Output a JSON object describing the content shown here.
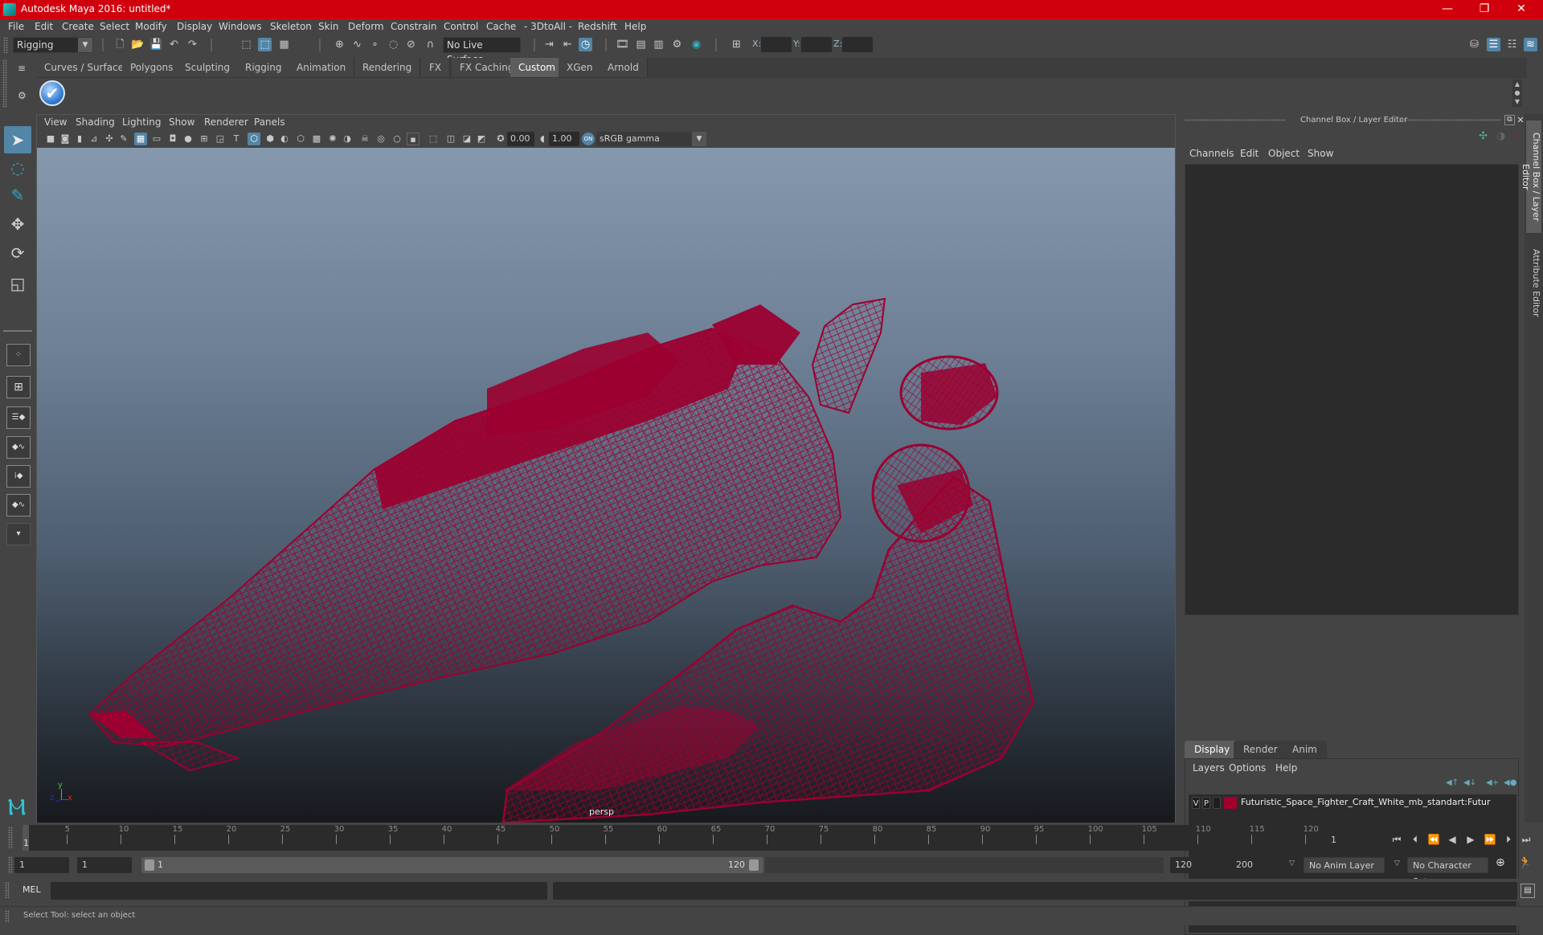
{
  "window": {
    "title": "Autodesk Maya 2016: untitled*",
    "controls": {
      "minimize": "—",
      "restore": "❐",
      "close": "✕"
    }
  },
  "menubar": [
    "File",
    "Edit",
    "Create",
    "Select",
    "Modify",
    "Display",
    "Windows",
    "Skeleton",
    "Skin",
    "Deform",
    "Constrain",
    "Control",
    "Cache",
    "- 3DtoAll -",
    "Redshift",
    "Help"
  ],
  "statusline": {
    "menuset": "Rigging",
    "live_surface": "No Live Surface",
    "x_label": "X:",
    "y_label": "Y:",
    "z_label": "Z:",
    "x_value": "",
    "y_value": "",
    "z_value": ""
  },
  "shelf": {
    "tabs": [
      "Curves / Surfaces",
      "Polygons",
      "Sculpting",
      "Rigging",
      "Animation",
      "Rendering",
      "FX",
      "FX Caching",
      "Custom",
      "XGen",
      "Arnold"
    ],
    "active_tab": "Custom",
    "items": [
      {
        "icon": "checkmark-icon",
        "glyph": "✔"
      }
    ]
  },
  "viewport": {
    "menu": [
      "View",
      "Shading",
      "Lighting",
      "Show",
      "Renderer",
      "Panels"
    ],
    "exposure": "0.00",
    "gamma": "1.00",
    "color_space": "sRGB gamma",
    "camera_label": "persp",
    "axis": {
      "x": "x",
      "y": "y",
      "z": "z"
    },
    "wireframe_color": "#9b0030"
  },
  "channel_box": {
    "title": "Channel Box / Layer Editor",
    "menu": [
      "Channels",
      "Edit",
      "Object",
      "Show"
    ]
  },
  "layer_editor": {
    "tabs": [
      "Display",
      "Render",
      "Anim"
    ],
    "active_tab": "Display",
    "menu": [
      "Layers",
      "Options",
      "Help"
    ],
    "layers": [
      {
        "visible": "V",
        "playback": "P",
        "color": "#a0002a",
        "name": "Futuristic_Space_Fighter_Craft_White_mb_standart:Futur"
      }
    ]
  },
  "side_tabs": [
    "Channel Box / Layer Editor",
    "Attribute Editor"
  ],
  "timeline": {
    "ticks": [
      5,
      10,
      15,
      20,
      25,
      30,
      35,
      40,
      45,
      50,
      55,
      60,
      65,
      70,
      75,
      80,
      85,
      90,
      95,
      100,
      105,
      110,
      115,
      120
    ],
    "range_min": 1,
    "range_max": 120,
    "current_frame": "1",
    "current_frame_field": "1"
  },
  "range": {
    "start_time": "1",
    "playback_start": "1",
    "slider_start": "1",
    "slider_end": "120",
    "playback_end": "120",
    "end_time": "200",
    "anim_layer": "No Anim Layer",
    "character_set": "No Character Set"
  },
  "command_line": {
    "label": "MEL",
    "value": "",
    "output": ""
  },
  "help_line": "Select Tool: select an object"
}
